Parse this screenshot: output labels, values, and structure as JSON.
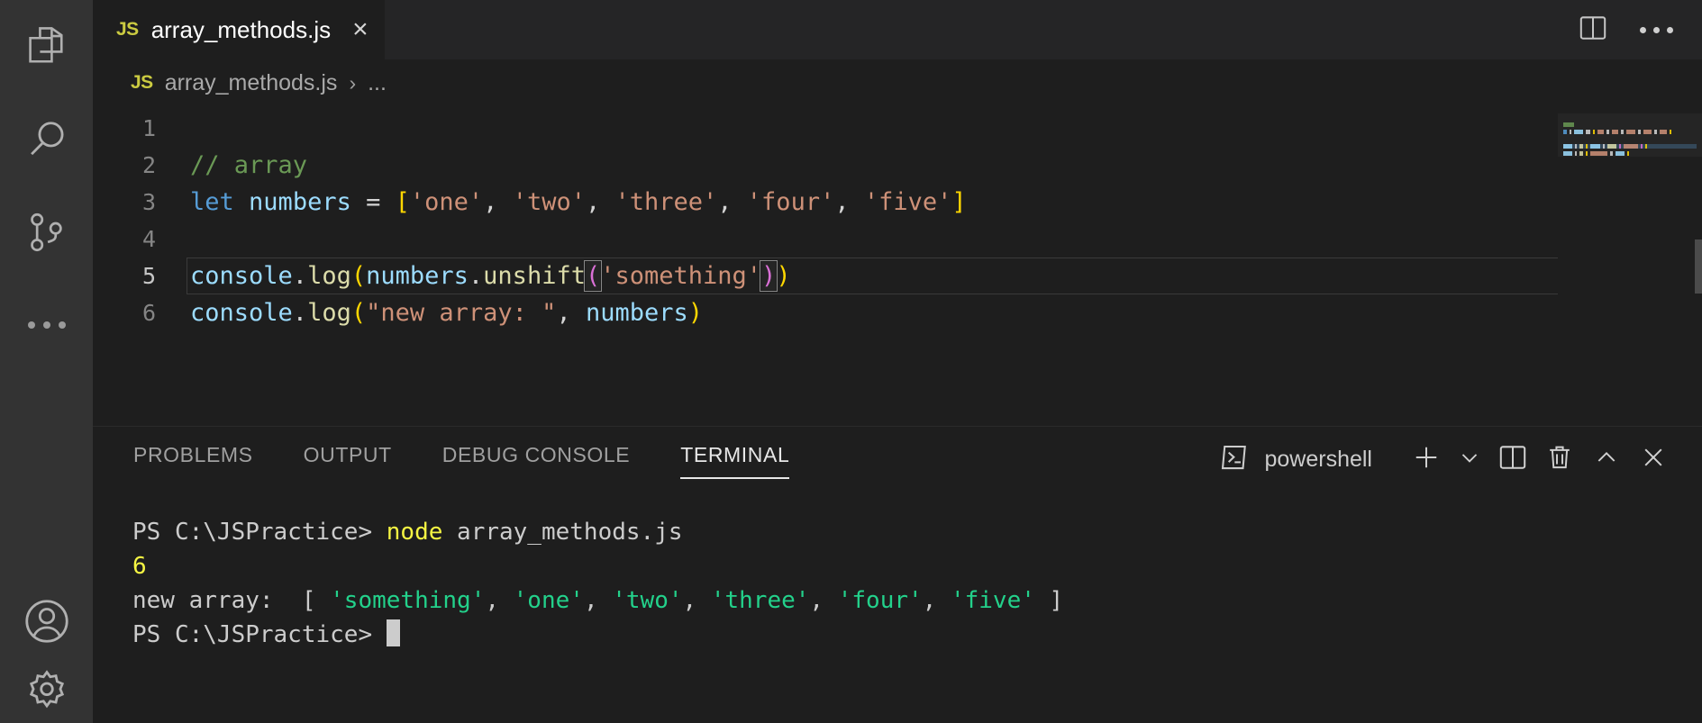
{
  "activity_bar": {
    "items": [
      {
        "name": "explorer-icon",
        "label": "Explorer"
      },
      {
        "name": "search-icon",
        "label": "Search"
      },
      {
        "name": "source-control-icon",
        "label": "Source Control"
      },
      {
        "name": "more-views-icon",
        "label": "..."
      }
    ],
    "bottom_items": [
      {
        "name": "account-icon",
        "label": "Account"
      },
      {
        "name": "settings-gear-icon",
        "label": "Manage"
      }
    ]
  },
  "tabs": {
    "active_tab": {
      "badge": "JS",
      "label": "array_methods.js",
      "close": "×"
    },
    "actions": [
      {
        "name": "split-editor-icon",
        "label": "Split Editor"
      },
      {
        "name": "more-actions-icon",
        "label": "More Actions..."
      }
    ]
  },
  "breadcrumb": {
    "badge": "JS",
    "file": "array_methods.js",
    "separator": "›",
    "overflow": "..."
  },
  "editor": {
    "lines": [
      {
        "num": "1",
        "tokens": []
      },
      {
        "num": "2",
        "tokens": [
          {
            "cls": "tok-comment",
            "text": "// array"
          }
        ]
      },
      {
        "num": "3",
        "tokens": [
          {
            "cls": "tok-kw",
            "text": "let"
          },
          {
            "cls": "tok-op",
            "text": " "
          },
          {
            "cls": "tok-var",
            "text": "numbers"
          },
          {
            "cls": "tok-op",
            "text": " = "
          },
          {
            "cls": "tok-brk1",
            "text": "["
          },
          {
            "cls": "tok-str",
            "text": "'one'"
          },
          {
            "cls": "tok-punc",
            "text": ", "
          },
          {
            "cls": "tok-str",
            "text": "'two'"
          },
          {
            "cls": "tok-punc",
            "text": ", "
          },
          {
            "cls": "tok-str",
            "text": "'three'"
          },
          {
            "cls": "tok-punc",
            "text": ", "
          },
          {
            "cls": "tok-str",
            "text": "'four'"
          },
          {
            "cls": "tok-punc",
            "text": ", "
          },
          {
            "cls": "tok-str",
            "text": "'five'"
          },
          {
            "cls": "tok-brk1",
            "text": "]"
          }
        ]
      },
      {
        "num": "4",
        "tokens": []
      },
      {
        "num": "5",
        "current": true,
        "tokens": [
          {
            "cls": "tok-var",
            "text": "console"
          },
          {
            "cls": "tok-punc",
            "text": "."
          },
          {
            "cls": "tok-fn",
            "text": "log"
          },
          {
            "cls": "tok-brk1",
            "text": "("
          },
          {
            "cls": "tok-var",
            "text": "numbers"
          },
          {
            "cls": "tok-punc",
            "text": "."
          },
          {
            "cls": "tok-fn",
            "text": "unshift"
          },
          {
            "cls": "tok-brk2 bracket-match",
            "text": "("
          },
          {
            "cls": "tok-str",
            "text": "'something'"
          },
          {
            "cls": "tok-brk2 bracket-match",
            "text": ")"
          },
          {
            "cls": "tok-brk1",
            "text": ")"
          }
        ]
      },
      {
        "num": "6",
        "tokens": [
          {
            "cls": "tok-var",
            "text": "console"
          },
          {
            "cls": "tok-punc",
            "text": "."
          },
          {
            "cls": "tok-fn",
            "text": "log"
          },
          {
            "cls": "tok-brk1",
            "text": "("
          },
          {
            "cls": "tok-str",
            "text": "\"new array: \""
          },
          {
            "cls": "tok-punc",
            "text": ", "
          },
          {
            "cls": "tok-var",
            "text": "numbers"
          },
          {
            "cls": "tok-brk1",
            "text": ")"
          }
        ]
      }
    ]
  },
  "panel": {
    "tabs": [
      {
        "label": "PROBLEMS",
        "active": false
      },
      {
        "label": "OUTPUT",
        "active": false
      },
      {
        "label": "DEBUG CONSOLE",
        "active": false
      },
      {
        "label": "TERMINAL",
        "active": true
      }
    ],
    "terminal_name": "powershell",
    "actions": [
      {
        "name": "terminal-powershell-icon",
        "label": "powershell"
      },
      {
        "name": "new-terminal-icon",
        "label": "+"
      },
      {
        "name": "terminal-dropdown-icon",
        "label": "v"
      },
      {
        "name": "split-terminal-icon",
        "label": "Split Terminal"
      },
      {
        "name": "kill-terminal-icon",
        "label": "Kill Terminal"
      },
      {
        "name": "maximize-panel-icon",
        "label": "Maximize Panel Size"
      },
      {
        "name": "close-panel-icon",
        "label": "Close Panel"
      }
    ]
  },
  "terminal": {
    "rows": [
      {
        "segments": [
          {
            "cls": "t-white",
            "text": "PS C:\\JSPractice> "
          },
          {
            "cls": "t-yellow",
            "text": "node"
          },
          {
            "cls": "t-white",
            "text": " array_methods.js"
          }
        ]
      },
      {
        "segments": [
          {
            "cls": "t-yellow",
            "text": "6"
          }
        ]
      },
      {
        "segments": [
          {
            "cls": "t-white",
            "text": "new array:  [ "
          },
          {
            "cls": "t-green",
            "text": "'something'"
          },
          {
            "cls": "t-white",
            "text": ", "
          },
          {
            "cls": "t-green",
            "text": "'one'"
          },
          {
            "cls": "t-white",
            "text": ", "
          },
          {
            "cls": "t-green",
            "text": "'two'"
          },
          {
            "cls": "t-white",
            "text": ", "
          },
          {
            "cls": "t-green",
            "text": "'three'"
          },
          {
            "cls": "t-white",
            "text": ", "
          },
          {
            "cls": "t-green",
            "text": "'four'"
          },
          {
            "cls": "t-white",
            "text": ", "
          },
          {
            "cls": "t-green",
            "text": "'five'"
          },
          {
            "cls": "t-white",
            "text": " ]"
          }
        ]
      },
      {
        "cursor": true,
        "segments": [
          {
            "cls": "t-white",
            "text": "PS C:\\JSPractice> "
          }
        ]
      }
    ]
  },
  "colors": {
    "editor_bg": "#1e1e1e",
    "activitybar_bg": "#333333",
    "tab_inactive_bg": "#252526",
    "accent": "#007acc",
    "js_badge": "#cbcb41",
    "terminal_green": "#23d18b",
    "terminal_yellow": "#f5f543"
  }
}
